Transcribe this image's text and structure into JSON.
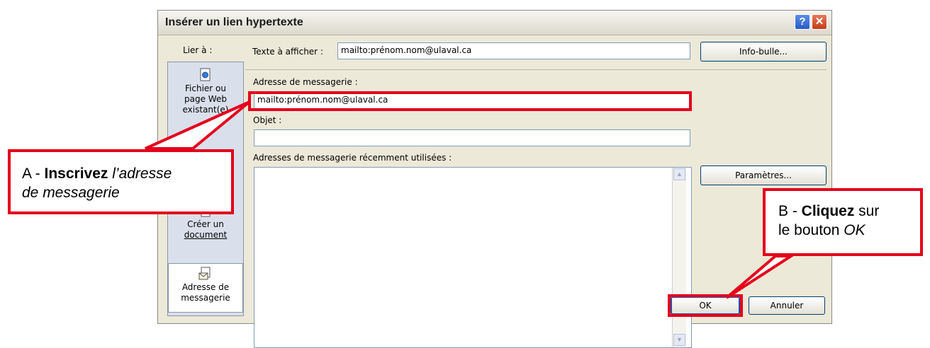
{
  "dialog": {
    "title": "Insérer un lien hypertexte",
    "help_label": "?",
    "close_label": "✕"
  },
  "left": {
    "header": "Lier à :",
    "items": [
      {
        "line1": "Fichier ou",
        "line2": "page Web",
        "line3": "existant(e)",
        "icon": "web-page-icon"
      },
      {
        "line1": "Créer un",
        "line2": "document",
        "icon": "new-document-icon"
      },
      {
        "line1": "Adresse de",
        "line2": "messagerie",
        "icon": "email-icon"
      }
    ]
  },
  "form": {
    "text_label": "Texte à afficher :",
    "text_value": "mailto:prénom.nom@ulaval.ca",
    "tooltip_button": "Info-bulle...",
    "email_label": "Adresse de messagerie :",
    "email_value": "mailto:prénom.nom@ulaval.ca",
    "subject_label": "Objet :",
    "subject_value": "",
    "recent_label": "Adresses de messagerie récemment utilisées :",
    "params_button": "Paramètres...",
    "ok_button": "OK",
    "cancel_button": "Annuler"
  },
  "annotations": {
    "a_prefix": "A - ",
    "a_bold": "Inscrivez",
    "a_italic1": " l’adresse",
    "a_italic2": "de messagerie",
    "b_prefix": "B - ",
    "b_bold": "Cliquez",
    "b_rest1": " sur",
    "b_rest2": "le bouton ",
    "b_italic": "OK"
  },
  "colors": {
    "annotation_red": "#e4001b",
    "dialog_bg": "#ece9d8",
    "selected_nav_bg": "#ffffff"
  }
}
